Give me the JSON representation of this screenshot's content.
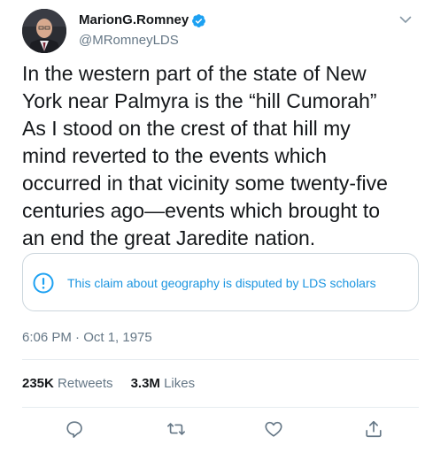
{
  "author": {
    "display_name": "MarionG.Romney",
    "handle": "@MRomneyLDS",
    "verified": true
  },
  "tweet": {
    "lines": [
      "In the western part of the state of New",
      "York near Palmyra is the “hill Cumorah”",
      "As I stood on the crest of that hill my",
      "mind reverted to the events which",
      "occurred in that vicinity some twenty-five",
      "centuries ago—events which brought to",
      "an end the great Jaredite nation."
    ],
    "notice": "This claim about geography is disputed by LDS scholars",
    "timestamp": "6:06 PM · Oct 1, 1975"
  },
  "stats": {
    "retweets_count": "235K",
    "retweets_label": "Retweets",
    "likes_count": "3.3M",
    "likes_label": "Likes"
  },
  "actions": [
    "reply-icon",
    "retweet-icon",
    "like-icon",
    "share-icon"
  ],
  "colors": {
    "accent": "#1da1f2",
    "notice_text": "#1b95e0",
    "secondary_text": "#657786",
    "border": "#ccd6dd"
  }
}
